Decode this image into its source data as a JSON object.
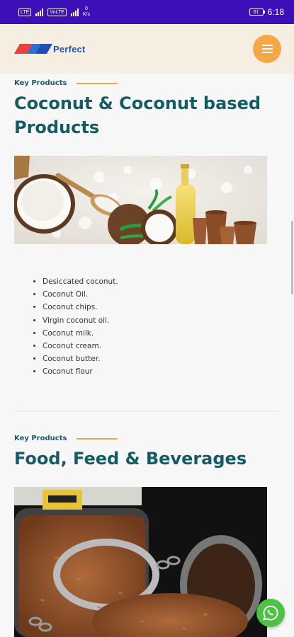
{
  "status_bar": {
    "sim1": "LTE",
    "sim2": "VoLTE",
    "net_speed_value": "0",
    "net_speed_unit": "K/s",
    "battery": "61",
    "time": "6:18"
  },
  "header": {
    "logo_text": "Perfect",
    "logo_colors": [
      "#e8423a",
      "#2f6fd6",
      "#1e4fb4"
    ],
    "menu_icon": "hamburger-menu-icon"
  },
  "sections": [
    {
      "key_label": "Key Products",
      "title": "Coconut & Coconut based Products",
      "image_alt": "Coconut products image",
      "items": [
        "Desiccated coconut.",
        "Coconut Oil.",
        "Coconut chips.",
        "Virgin coconut oil.",
        "Coconut milk.",
        "Coconut cream.",
        "Coconut butter.",
        "Coconut flour"
      ]
    },
    {
      "key_label": "Key Products",
      "title": "Food, Feed & Beverages",
      "image_alt": "Jar of flax seeds image"
    }
  ],
  "floating": {
    "whatsapp_icon": "whatsapp-icon"
  },
  "colors": {
    "status_bar": "#3d0fb8",
    "header_bg": "#f4efe0",
    "accent_orange": "#f5a748",
    "title_teal": "#145c63",
    "whatsapp_green": "#4dc247"
  }
}
